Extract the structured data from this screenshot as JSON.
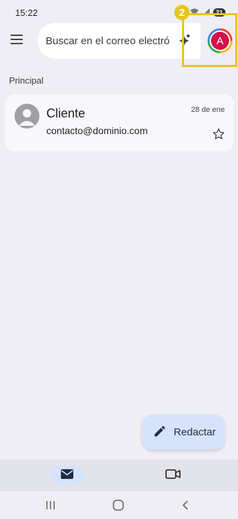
{
  "status": {
    "time": "15:22",
    "battery": "21"
  },
  "search": {
    "placeholder": "Buscar en el correo electrónico"
  },
  "annotation": {
    "badge": "2"
  },
  "account": {
    "initial": "A",
    "avatar_color": "#d0134a"
  },
  "inbox": {
    "section_label": "Principal"
  },
  "emails": [
    {
      "sender": "Cliente",
      "snippet": "contacto@dominio.com",
      "date": "28 de ene",
      "starred": false
    }
  ],
  "compose": {
    "label": "Redactar"
  },
  "bottom_nav": {
    "items": [
      {
        "icon": "mail-icon",
        "selected": true
      },
      {
        "icon": "video-icon",
        "selected": false
      }
    ]
  },
  "system_nav": {
    "items": [
      "recent-apps-icon",
      "home-icon",
      "back-icon"
    ]
  },
  "colors": {
    "background": "#eeeef4",
    "card": "#f8f8fc",
    "compose": "#d7e3fb",
    "highlight": "#e8c51e"
  }
}
